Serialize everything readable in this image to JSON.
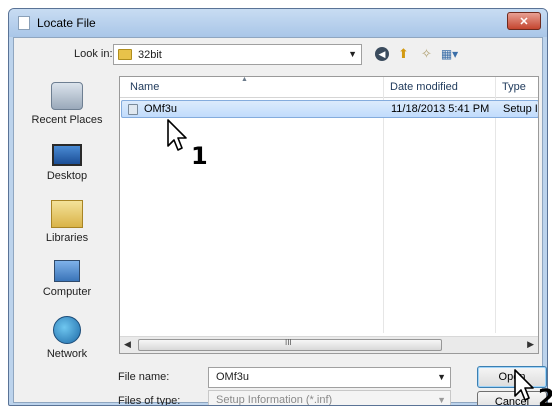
{
  "window": {
    "title": "Locate File",
    "close_glyph": "✕"
  },
  "toolbar": {
    "look_in_label": "Look in:",
    "look_in_value": "32bit",
    "icons": [
      "back-icon",
      "up-folder-icon",
      "new-folder-icon",
      "views-menu-icon"
    ]
  },
  "places": [
    {
      "label": "Recent Places",
      "icon": "recent-places-icon"
    },
    {
      "label": "Desktop",
      "icon": "desktop-icon"
    },
    {
      "label": "Libraries",
      "icon": "libraries-icon"
    },
    {
      "label": "Computer",
      "icon": "computer-icon"
    },
    {
      "label": "Network",
      "icon": "network-icon"
    }
  ],
  "filelist": {
    "columns": [
      "Name",
      "Date modified",
      "Type"
    ],
    "rows": [
      {
        "name": "OMf3u",
        "date_modified": "11/18/2013 5:41 PM",
        "type": "Setup Info"
      }
    ],
    "scroll_grip": "III"
  },
  "footer": {
    "file_name_label": "File name:",
    "file_name_value": "OMf3u",
    "files_of_type_label": "Files of type:",
    "files_of_type_value": "Setup Information (*.inf)",
    "open_label": "Open",
    "cancel_label": "Cancel"
  },
  "annotations": {
    "step1": "1",
    "step2": "2"
  },
  "colors": {
    "selection": "#c1dcfc",
    "title_bar": "#bcd3ec",
    "close_button": "#c4452f"
  }
}
